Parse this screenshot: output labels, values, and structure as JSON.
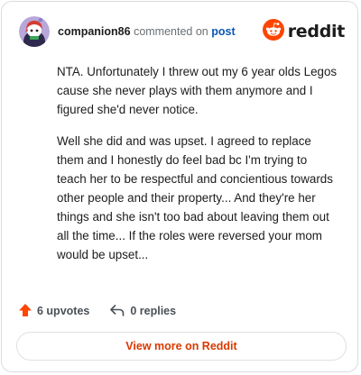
{
  "comment": {
    "author": "companion86",
    "action_text": "commented on",
    "post_link_label": "post",
    "paragraphs": [
      "NTA. Unfortunately I threw out my 6 year olds Legos cause she never plays with them anymore and I figured she'd never notice.",
      "Well she did and was upset. I agreed to replace them and I honestly do feel bad bc I'm trying to teach her to be respectful and concientious towards other people and their property... And they're her things and she isn't too bad about leaving them out all the time... If the roles were reversed your mom would be upset..."
    ],
    "upvotes_label": "6 upvotes",
    "replies_label": "0 replies"
  },
  "brand": {
    "wordmark": "reddit",
    "color": "#ff4500"
  },
  "footer": {
    "view_more_label": "View more on Reddit"
  },
  "colors": {
    "upvote": "#ff4500",
    "link": "#0a58b4",
    "view_more": "#d93900"
  },
  "icons": {
    "avatar": "avatar",
    "logo": "reddit-snoo-icon",
    "upvote": "upvote-arrow-icon",
    "reply": "reply-arrow-icon"
  }
}
